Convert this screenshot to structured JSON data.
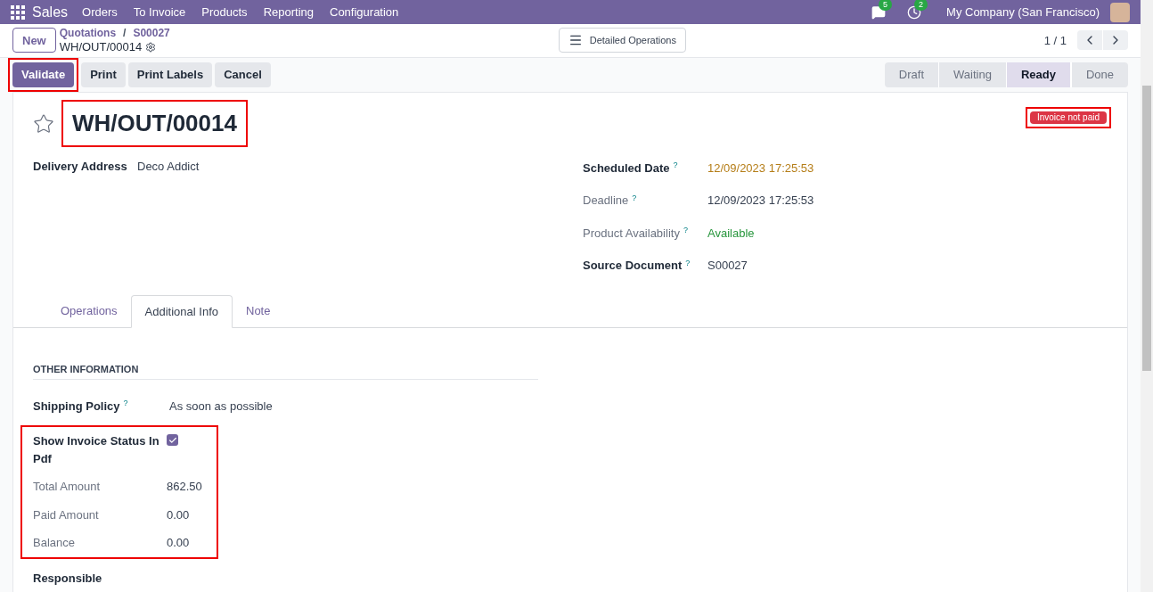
{
  "navbar": {
    "app": "Sales",
    "menu": [
      "Orders",
      "To Invoice",
      "Products",
      "Reporting",
      "Configuration"
    ],
    "messages_count": "5",
    "activities_count": "2",
    "company": "My Company (San Francisco)"
  },
  "breadcrumb": {
    "new_button": "New",
    "separator": "/",
    "path": [
      "Quotations",
      "S00027"
    ],
    "current": "WH/OUT/00014"
  },
  "view_button": "Detailed Operations",
  "pager": "1 / 1",
  "actions": [
    {
      "label": "Validate",
      "primary": true,
      "highlighted": true
    },
    {
      "label": "Print",
      "primary": false,
      "highlighted": false
    },
    {
      "label": "Print Labels",
      "primary": false,
      "highlighted": false
    },
    {
      "label": "Cancel",
      "primary": false,
      "highlighted": false
    }
  ],
  "stages": [
    {
      "label": "Draft",
      "selected": false
    },
    {
      "label": "Waiting",
      "selected": false
    },
    {
      "label": "Ready",
      "selected": true
    },
    {
      "label": "Done",
      "selected": false
    }
  ],
  "record": {
    "starred": false,
    "title": "WH/OUT/00014",
    "title_highlighted": true,
    "ribbon": {
      "label": "Invoice not paid",
      "highlighted": true
    },
    "left_fields": [
      {
        "label": "Delivery Address",
        "value": "Deco Addict",
        "readonly": false,
        "color": "#374151"
      }
    ],
    "right_fields": [
      {
        "label": "Scheduled Date",
        "help": "?",
        "value": "12/09/2023 17:25:53",
        "readonly": false,
        "color": "#b57d17"
      },
      {
        "label": "Deadline",
        "help": "?",
        "value": "12/09/2023 17:25:53",
        "readonly": true,
        "color": "#374151"
      },
      {
        "label": "Product Availability",
        "help": "?",
        "value": "Available",
        "readonly": true,
        "color": "#28963d"
      },
      {
        "label": "Source Document",
        "help": "?",
        "value": "S00027",
        "readonly": false,
        "color": "#374151"
      }
    ]
  },
  "tabs": [
    {
      "label": "Operations",
      "selected": false
    },
    {
      "label": "Additional Info",
      "selected": true
    },
    {
      "label": "Note",
      "selected": false
    }
  ],
  "section": {
    "title": "OTHER INFORMATION",
    "fields": [
      {
        "label": "Shipping Policy",
        "help": "?",
        "value": "As soon as possible",
        "readonly": false
      }
    ],
    "invoice_status": {
      "highlighted": true,
      "fields": [
        {
          "kind": "checkbox",
          "label": "Show Invoice Status In Pdf",
          "checked": true,
          "readonly": false
        },
        {
          "kind": "text",
          "label": "Total Amount",
          "value": "862.50",
          "readonly": true
        },
        {
          "kind": "text",
          "label": "Paid Amount",
          "value": "0.00",
          "readonly": true
        },
        {
          "kind": "text",
          "label": "Balance",
          "value": "0.00",
          "readonly": true
        }
      ]
    },
    "trailing_fields": [
      {
        "label": "Responsible",
        "readonly": false
      }
    ]
  }
}
